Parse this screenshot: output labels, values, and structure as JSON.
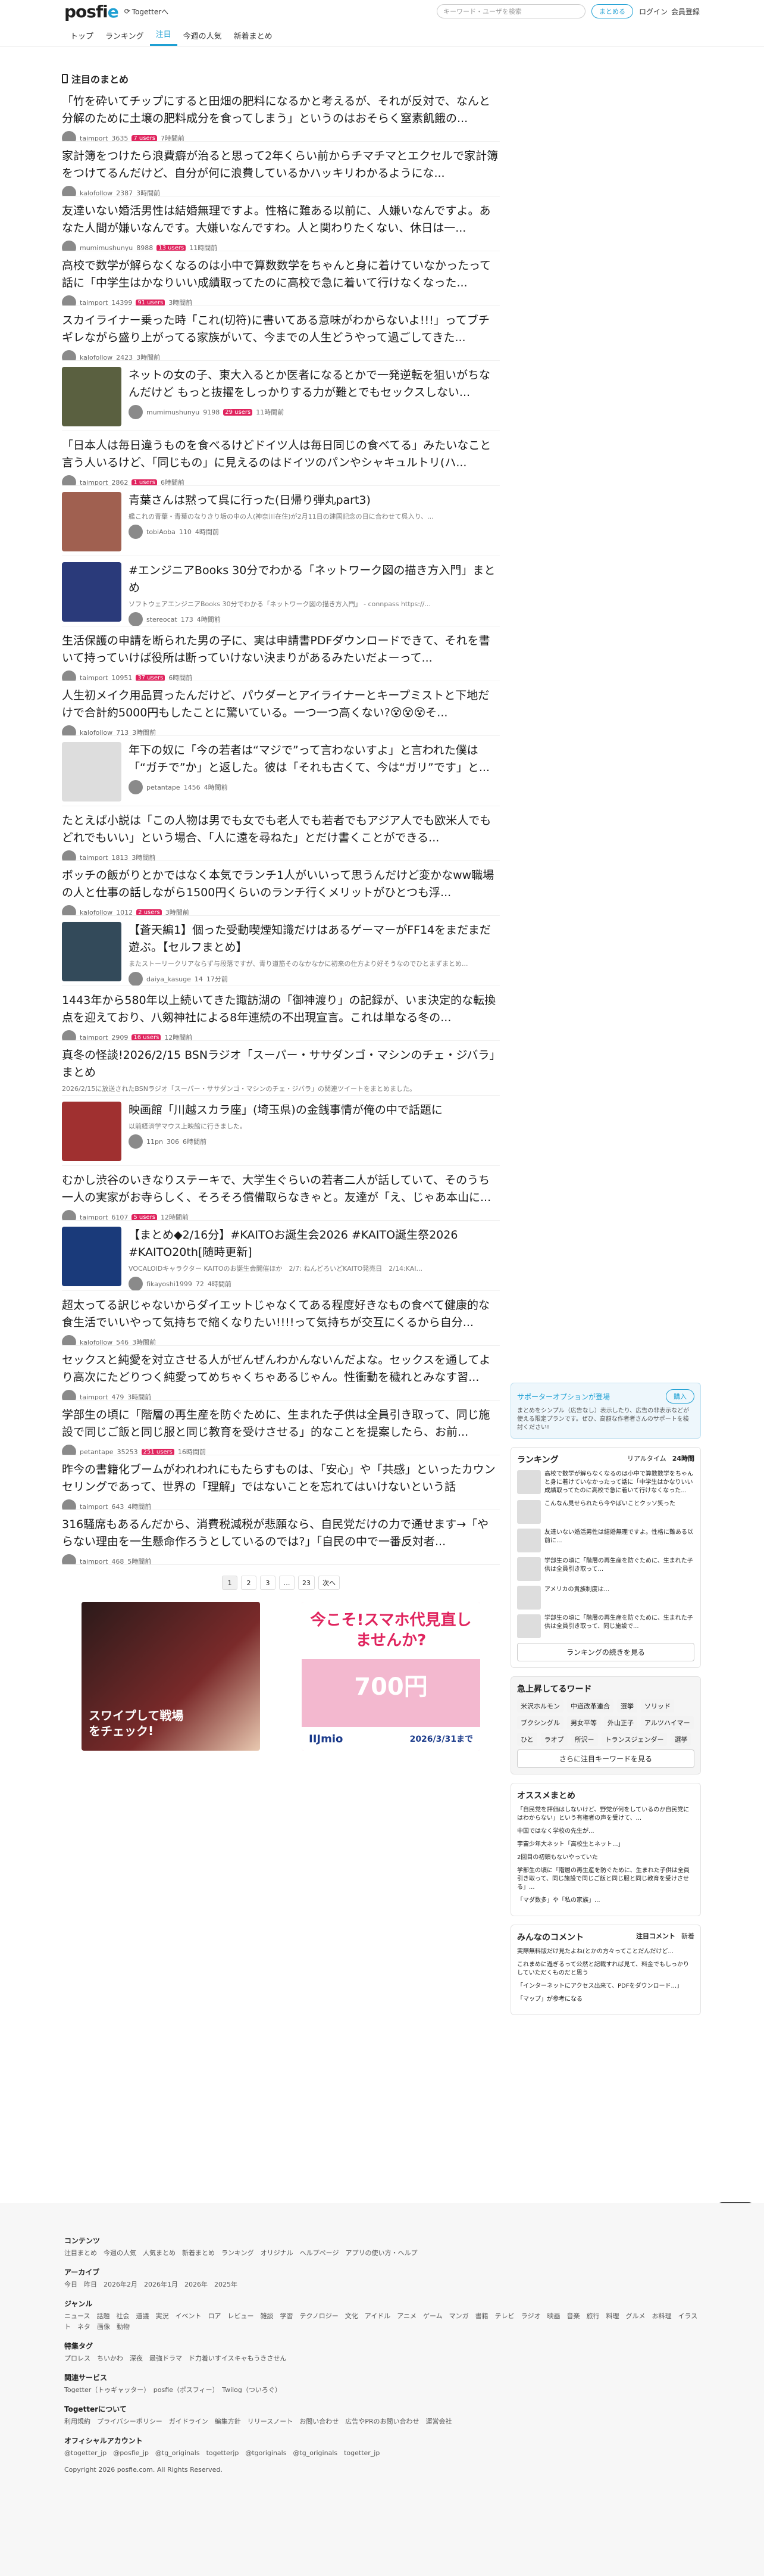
{
  "header": {
    "logo_main": "posfi",
    "logo_e": "e",
    "togetter": "Togetterへ",
    "search_placeholder": "キーワード・ユーザを検索",
    "make_btn": "まとめる",
    "login": "ログイン",
    "register": "会員登録"
  },
  "tabs": [
    "トップ",
    "ランキング",
    "注目",
    "今週の人気",
    "新着まとめ"
  ],
  "section_title": "注目のまとめ",
  "entries": [
    {
      "title": "「竹を砕いてチップにすると田畑の肥料になるかと考えるが、それが反対で、なんと分解のために土壌の肥料成分を食ってしまう」というのはおそらく窒素飢餓の...",
      "user": "taimport",
      "views": "3635",
      "time": "7時間前",
      "color": "#6a8e4e",
      "hot": "7 users"
    },
    {
      "title": "家計簿をつけたら浪費癖が治ると思って2年くらい前からチマチマとエクセルで家計簿をつけてるんだけど、自分が何に浪費しているかハッキリわかるようにな...",
      "user": "kalofollow",
      "views": "2387",
      "time": "3時間前",
      "color": "#8a6a4e",
      "hot": ""
    },
    {
      "title": "友達いない婚活男性は結婚無理ですよ。性格に難ある以前に、人嫌いなんですよ。あなた人間が嫌いなんです。大嫌いなんですわ。人と関わりたくない、休日は一...",
      "user": "mumimushunyu",
      "views": "8988",
      "time": "11時間前",
      "color": "#4e6e8a",
      "hot": "13 users"
    },
    {
      "title": "高校で数学が解らなくなるのは小中で算数数学をちゃんと身に着けていなかったって話に「中学生はかなりいい成績取ってたのに高校で急に着いて行けなくなった...",
      "user": "taimport",
      "views": "14399",
      "time": "3時間前",
      "color": "#6a8e4e",
      "hot": "91 users"
    },
    {
      "title": "スカイライナー乗った時「これ(切符)に書いてある意味がわからないよ!!!」ってブチギレながら盛り上がってる家族がいて、今までの人生どうやって過ごしてきた...",
      "user": "kalofollow",
      "views": "2423",
      "time": "3時間前",
      "color": "#8a6a4e",
      "hot": ""
    }
  ],
  "img_entries": [
    {
      "title": "ネットの女の子、東大入るとか医者になるとかで一発逆転を狙いがちなんだけど もっと抜擢をしっかりする力が難とでもセックスしない...",
      "user": "mumimushunyu",
      "views": "9198",
      "time": "11時間前",
      "hot": "29 users",
      "thumb": "#5a6040"
    }
  ],
  "entries2": [
    {
      "title": "「日本人は毎日違うものを食べるけどドイツ人は毎日同じの食べてる」みたいなこと言う人いるけど、「同じもの」に見えるのはドイツのパンやシャキュルトリ(ハ...",
      "user": "taimport",
      "views": "2862",
      "time": "6時間前",
      "hot": "1 users"
    }
  ],
  "img_entries2": [
    {
      "title": "青葉さんは黙って呉に行った(日帰り弾丸part3)",
      "desc": "艦これの青葉・青葉のなりきり垢の中の人(神奈川在住)が2月11日の建国記念の日に合わせて呉入り、...",
      "user": "tobiAoba",
      "views": "110",
      "time": "4時間前",
      "thumb": "#a06050"
    },
    {
      "title": "#エンジニアBooks 30分でわかる「ネットワーク図の描き方入門」まとめ",
      "desc": "ソフトウェアエンジニアBooks 30分でわかる「ネットワーク図の描き方入門」 - connpass https://...",
      "user": "stereocat",
      "views": "173",
      "time": "4時間前",
      "thumb": "#2a3a7a"
    }
  ],
  "entries3": [
    {
      "title": "生活保護の申請を断られた男の子に、実は申請書PDFダウンロードできて、それを書いて持っていけば役所は断っていけない決まりがあるみたいだよーって...",
      "user": "taimport",
      "views": "10951",
      "time": "6時間前",
      "hot": "37 users"
    },
    {
      "title": "人生初メイク用品買ったんだけど、パウダーとアイライナーとキープミストと下地だけで合計約5000円もしたことに驚いている。一つ一つ高くない?😵😵😵そ...",
      "user": "kalofollow",
      "views": "713",
      "time": "3時間前",
      "hot": ""
    }
  ],
  "img_entries3": [
    {
      "title": "年下の奴に「今の若者は“マジで”って言わないすよ」と言われた僕は「“ガチで”か」と返した。彼は「それも古くて、今は“ガリ”です」と...",
      "user": "petantape",
      "views": "1456",
      "time": "4時間前",
      "thumb": "#ddd"
    }
  ],
  "entries4": [
    {
      "title": "たとえば小説は「この人物は男でも女でも老人でも若者でもアジア人でも欧米人でもどれでもいい」という場合、「人に遠を尋ねた」とだけ書くことができる...",
      "user": "taimport",
      "views": "1813",
      "time": "3時間前",
      "hot": ""
    },
    {
      "title": "ボッチの飯がりとかではなく本気でランチ1人がいいって思うんだけど変かなww職場の人と仕事の話しながら1500円くらいのランチ行くメリットがひとつも浮...",
      "user": "kalofollow",
      "views": "1012",
      "time": "3時間前",
      "hot": "2 users"
    }
  ],
  "img_entries4": [
    {
      "title": "【蒼天編1】個った受動喫煙知識だけはあるゲーマーがFF14をまだまだ遊ぶ。【セルフまとめ】",
      "desc": "またストーリークリアならず与段落ですが、青り道筋そのなかなかに初来の仕方より好そうなのでひとまずまとめ...",
      "user": "daiya_kasuge",
      "views": "14",
      "time": "17分前",
      "thumb": "#334a5a"
    }
  ],
  "entries5": [
    {
      "title": "1443年から580年以上続いてきた諏訪湖の「御神渡り」の記録が、いま決定的な転換点を迎えており、八剱神社による8年連続の不出現宣言。これは単なる冬の...",
      "user": "taimport",
      "views": "2909",
      "time": "12時間前",
      "hot": "16 users"
    },
    {
      "title": "真冬の怪談!2026/2/15 BSNラジオ「スーパー・ササダンゴ・マシンのチェ・ジバラ」まとめ",
      "user": "fomura_kee",
      "views": "26",
      "time": "58分前",
      "hot": "",
      "desc": "2026/2/15に放送されたBSNラジオ「スーパー・ササダンゴ・マシンのチェ・ジバラ」の関連ツイートをまとめました。"
    }
  ],
  "img_entries5": [
    {
      "title": "映画館「川越スカラ座」(埼玉県)の金銭事情が俺の中で話題に",
      "desc": "以前経済学マウス上映館に行きました。",
      "user": "11pn",
      "views": "306",
      "time": "6時間前",
      "thumb": "#a03030"
    }
  ],
  "entries6": [
    {
      "title": "むかし渋谷のいきなりステーキで、大学生ぐらいの若者二人が話していて、そのうち一人の実家がお寺らしく、そろそろ償備取らなきゃと。友達が「え、じゃあ本山に...",
      "user": "taimport",
      "views": "6107",
      "time": "12時間前",
      "hot": "5 users"
    }
  ],
  "img_entries6": [
    {
      "title": "【まとめ◆2/16分】#KAITOお誕生会2026 #KAITO誕生祭2026 #KAITO20th[随時更新]",
      "desc": "VOCALOIDキャラクター KAITOのお誕生会開催ほか　2/7: ねんどろいどKAITO発売日　2/14:KAI...",
      "user": "fikayoshi1999",
      "views": "72",
      "time": "4時間前",
      "thumb": "#1a3a7a"
    }
  ],
  "entries7": [
    {
      "title": "超太ってる訳じゃないからダイエットじゃなくてある程度好きなもの食べて健康的な食生活でいいやって気持ちで縮くなりたい!!!!って気持ちが交互にくるから自分...",
      "user": "kalofollow",
      "views": "546",
      "time": "3時間前",
      "hot": ""
    },
    {
      "title": "セックスと純愛を対立させる人がぜんぜんわかんないんだよな。セックスを通してより高次にたどりつく純愛ってめちゃくちゃあるじゃん。性衝動を穢れとみなす習...",
      "user": "taimport",
      "views": "479",
      "time": "3時間前",
      "hot": ""
    },
    {
      "title": "学部生の頃に「階層の再生産を防ぐために、生まれた子供は全員引き取って、同じ施設で同じご飯と同じ服と同じ教育を受けさせる」的なことを提案したら、お前...",
      "user": "petantape",
      "views": "35253",
      "time": "16時間前",
      "hot": "251 users"
    },
    {
      "title": "昨今の書籍化ブームがわれわれにもたらすものは、「安心」や「共感」といったカウンセリングであって、世界の「理解」ではないことを忘れてはいけないという話",
      "user": "taimport",
      "views": "643",
      "time": "4時間前",
      "hot": ""
    },
    {
      "title": "316騒席もあるんだから、消費税減税が悲願なら、自民党だけの力で通せます→「やらない理由を一生懸命作ろうとしているのでは?」「自民の中で一番反対者...",
      "user": "taimport",
      "views": "468",
      "time": "5時間前",
      "hot": ""
    }
  ],
  "pager": [
    "1",
    "2",
    "3",
    "…",
    "23",
    "次へ"
  ],
  "ads": {
    "left_text": "スワイプして戦場をチェック!",
    "right_top": "今こそ!スマホ代見直しませんか?",
    "right_price": "700円",
    "right_brand": "IIJmio",
    "right_date": "2026/3/31まで"
  },
  "sidebar": {
    "support_title": "サポーターオプションが登場",
    "support_btn": "購入",
    "support_desc": "まとめをシンプル（広告なし）表示したり、広告の非表示などが使える限定プランです。ぜひ、高額な作者者さんのサポートを検討ください!",
    "ranking_title": "ランキング",
    "ranking_tabs": [
      "リアルタイム",
      "24時間"
    ],
    "ranking_items": [
      "高校で数学が解らなくなるのは小中で算数数学をちゃんと身に着けていなかったって話に「中学生はかなりいい成績取ってたのに高校で急に着いて行けなくなった...",
      "こんなん見せられたら今やばいことクッソ笑った",
      "友達いない婚活男性は結婚無理ですよ。性格に難ある以前に...",
      "学部生の頃に「階層の再生産を防ぐために、生まれた子供は全員引き取って...",
      "アメリカの貴族制度は...",
      "学部生の頃に「階層の再生産を防ぐために、生まれた子供は全員引き取って、同じ施設で..."
    ],
    "ranking_btn": "ランキングの続きを見る",
    "kw_title": "急上昇してるワード",
    "keywords": [
      "米沢ホルモン",
      "中道改革連合",
      "選挙",
      "ソリッド",
      "ブクシングル",
      "男女平等",
      "外山正子",
      "アルツハイマー",
      "ひと",
      "ラオプ",
      "所沢ー",
      "トランスジェンダー",
      "選挙"
    ],
    "kw_btn": "さらに注目キーワードを見る",
    "osusume_title": "オススメまとめ",
    "osusume": [
      "「自民党を評価はしないけど、野党が何をしているのか自民党にはわからない」という有権者の声を受けて、...",
      "中国ではなく学校の先生が...",
      "宇宙少年大ネット「高校生とネット...」",
      "2回目の初頭もないやっていた",
      "学部生の頃に「階層の再生産を防ぐために、生まれた子供は全員引き取って、同じ施設で同じご飯と同じ服と同じ教育を受けさせる」...",
      "「マダ数多」や「私の家族」..."
    ],
    "comment_title": "みんなのコメント",
    "comment_tabs": [
      "注目コメント",
      "新着"
    ],
    "comments": [
      "実際無料版だけ見たよね(とかの方々ってことだんだけど...",
      "これまめに過ぎるって公然と記載すれば見て、料金でもしっかりしていただくものだと思う",
      "「インターネットにアクセス出来て、PDFをダウンロード...」",
      "「マップ」が参考になる"
    ]
  },
  "footer": {
    "c1": "コンテンツ",
    "c1v": "注目まとめ　今週の人気　人気まとめ　新着まとめ　ランキング　オリジナル　ヘルプページ　アプリの使い方・ヘルプ",
    "c2": "アーカイブ",
    "c2v": "今日　昨日　2026年2月　2026年1月　2026年　2025年",
    "c3": "ジャンル",
    "c3v": "ニュース　話題　社会　道議　実況　イベント　ロア　レビュー　雑談　学習　テクノロジー　文化　アイドル　アニメ　ゲーム　マンガ　書籍　テレビ　ラジオ　映画　音楽　旅行　料理　グルメ　お料理　イラスト　ネタ　画像　動物",
    "c4": "特集タグ",
    "c4v": "プロレス　ちいかわ　深夜　最強ドラマ　ド力着いすイスキャもうきさせん",
    "c5": "関連サービス",
    "c5v": "Togetter（トゥギャッター）　posfie（ポスフィー）　Twilog（ついろぐ）",
    "c6": "Togetterについて",
    "c6v": "利用規約　プライバシーポリシー　ガイドライン　編集方針　リリースノート　お問い合わせ　広告やPRのお問い合わせ　運営会社",
    "c7": "オフィシャルアカウント",
    "c7v": "@togetter_jp　@posfie_jp　@tg_originals　togetterjp　@tgoriginals　@tg_originals　togetter_jp",
    "copy": "Copyright 2026 posfie.com. All Rights Reserved."
  }
}
